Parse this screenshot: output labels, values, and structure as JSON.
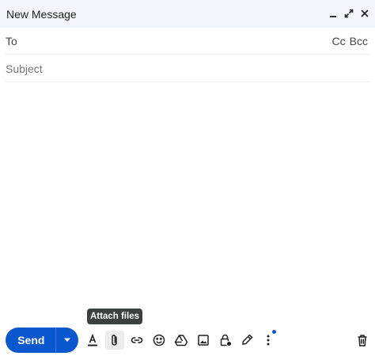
{
  "window": {
    "title": "New Message"
  },
  "header_icons": [
    "minimize-icon",
    "expand-icon",
    "close-icon"
  ],
  "to_row": {
    "label": "To",
    "cc": "Cc",
    "bcc": "Bcc"
  },
  "subject": {
    "placeholder": "Subject",
    "value": ""
  },
  "tooltip": {
    "text": "Attach files"
  },
  "send": {
    "label": "Send"
  },
  "toolbar": {
    "icons": [
      "text-format-icon",
      "paperclip-icon",
      "link-icon",
      "emoji-icon",
      "drive-icon",
      "image-icon",
      "confidential-lock-icon",
      "signature-pen-icon",
      "more-options-icon",
      "trash-icon"
    ]
  },
  "colors": {
    "header_bg": "#f2f6fc",
    "send_blue": "#0b57d0",
    "tooltip_bg": "#3c4043",
    "notify_dot": "#0b57d0"
  }
}
